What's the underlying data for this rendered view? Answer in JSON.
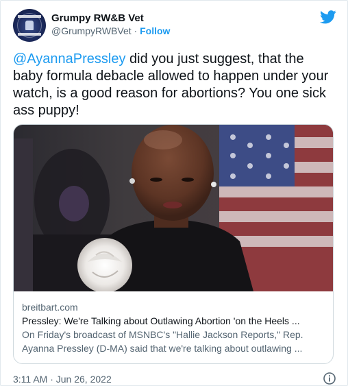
{
  "author": {
    "display_name": "Grumpy RW&B Vet",
    "handle": "@GrumpyRWBVet",
    "separator": "·",
    "follow_label": "Follow"
  },
  "tweet": {
    "mention": "@AyannaPressley",
    "text_after_mention": " did you just suggest, that the baby formula debacle allowed to happen under your watch, is a good reason for abortions? You one sick ass puppy!"
  },
  "card": {
    "domain": "breitbart.com",
    "title": "Pressley: We're Talking about Outlawing Abortion 'on the Heels ...",
    "description_line1": "On Friday's broadcast of MSNBC's \"Hallie Jackson Reports,\" Rep.",
    "description_line2": "Ayanna Pressley (D-MA) said that we're talking about outlawing ..."
  },
  "footer": {
    "timestamp": "3:11 AM · Jun 26, 2022"
  },
  "icons": {
    "brand": "twitter-bird-icon",
    "info": "info-icon"
  },
  "colors": {
    "accent": "#1d9bf0",
    "text": "#0f1419",
    "muted": "#536471",
    "border": "#cfd9de"
  }
}
